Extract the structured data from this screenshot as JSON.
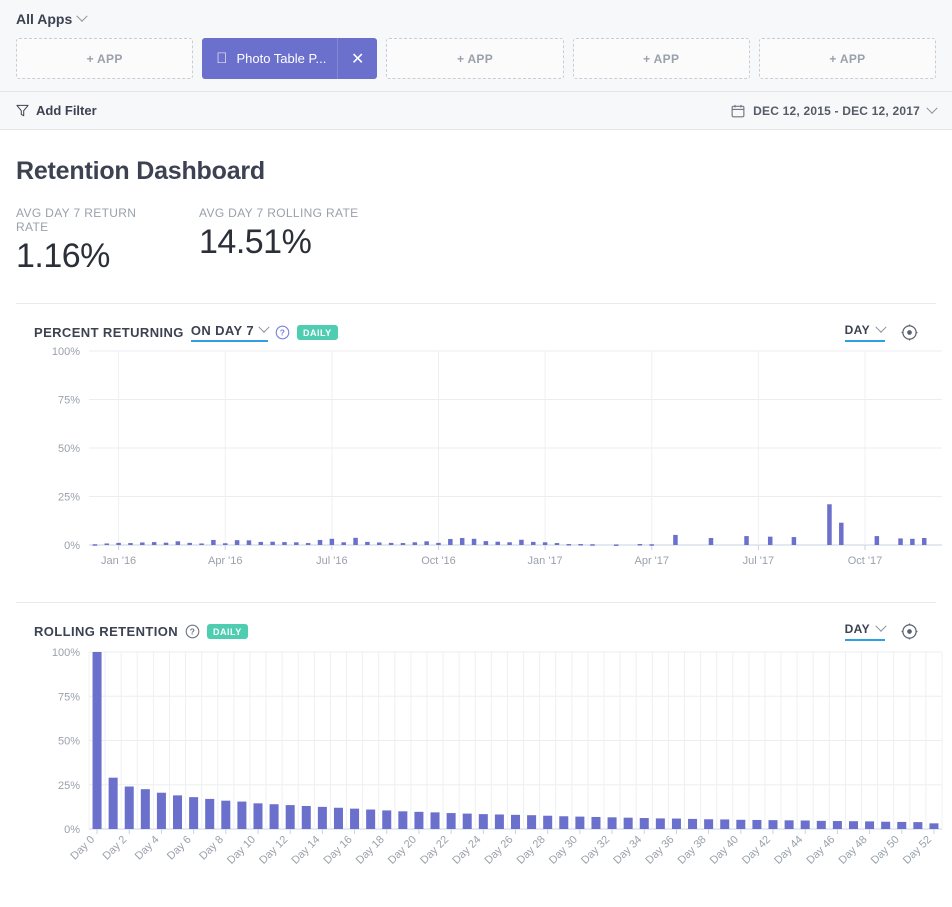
{
  "topbar": {
    "all_apps_label": "All Apps",
    "app_tabs": [
      {
        "label": "+ APP",
        "active": false
      },
      {
        "label": "Photo Table P...",
        "active": true,
        "icon": "apple-icon",
        "close_label": "✕"
      },
      {
        "label": "+ APP",
        "active": false
      },
      {
        "label": "+ APP",
        "active": false
      },
      {
        "label": "+ APP",
        "active": false
      }
    ]
  },
  "filterbar": {
    "add_filter_label": "Add Filter",
    "filter_icon": "funnel-icon",
    "date_range_label": "DEC 12, 2015 - DEC 12, 2017",
    "calendar_icon": "calendar-icon"
  },
  "page": {
    "title": "Retention Dashboard",
    "kpis": [
      {
        "label": "AVG DAY 7 RETURN RATE",
        "value": "1.16%"
      },
      {
        "label": "AVG DAY 7 ROLLING RATE",
        "value": "14.51%"
      }
    ]
  },
  "cards": [
    {
      "title_prefix": "PERCENT RETURNING",
      "title_dropdown": "ON DAY 7",
      "badge": "DAILY",
      "help_icon": "help-circle-icon",
      "granularity": "DAY",
      "settings_icon": "gear-icon"
    },
    {
      "title_prefix": "ROLLING RETENTION",
      "badge": "DAILY",
      "help_icon": "help-circle-icon",
      "granularity": "DAY",
      "settings_icon": "gear-icon"
    }
  ],
  "chart_data": [
    {
      "type": "bar",
      "title": "PERCENT RETURNING ON DAY 7",
      "xlabel": "",
      "ylabel": "",
      "ylim": [
        0,
        100
      ],
      "yticks": [
        0,
        25,
        50,
        75,
        100
      ],
      "ytick_labels": [
        "0%",
        "25%",
        "50%",
        "75%",
        "100%"
      ],
      "grid": true,
      "xtick_labels": [
        "Jan '16",
        "Apr '16",
        "Jul '16",
        "Oct '16",
        "Jan '17",
        "Apr '17",
        "Jul '17",
        "Oct '17"
      ],
      "xtick_positions": [
        2,
        11,
        20,
        29,
        38,
        47,
        56,
        65
      ],
      "color": "#6b70cc",
      "values": [
        0.4,
        0.8,
        1.1,
        1.0,
        1.3,
        1.5,
        1.2,
        1.9,
        1.1,
        0.8,
        2.6,
        0.9,
        2.5,
        2.4,
        1.6,
        1.7,
        1.5,
        1.4,
        1.0,
        2.6,
        3.2,
        1.4,
        3.7,
        1.6,
        1.3,
        1.1,
        1.0,
        1.4,
        1.9,
        1.1,
        3.1,
        3.6,
        3.2,
        2.0,
        1.7,
        1.4,
        2.7,
        1.6,
        1.4,
        1.0,
        0.5,
        0.5,
        0.4,
        0.0,
        0.3,
        0.0,
        0.5,
        0.4,
        0.0,
        5.2,
        0.0,
        0.0,
        3.6,
        0.0,
        0.0,
        4.6,
        0.0,
        4.3,
        0.0,
        4.1,
        0.0,
        0.0,
        21.0,
        11.5,
        0.0,
        0.0,
        4.6,
        0.0,
        3.4,
        3.2,
        3.6,
        0.0
      ]
    },
    {
      "type": "bar",
      "title": "ROLLING RETENTION",
      "xlabel": "",
      "ylabel": "",
      "ylim": [
        0,
        100
      ],
      "yticks": [
        0,
        25,
        50,
        75,
        100
      ],
      "ytick_labels": [
        "0%",
        "25%",
        "50%",
        "75%",
        "100%"
      ],
      "grid": true,
      "color": "#6b70cc",
      "categories": [
        "Day 0",
        "Day 1",
        "Day 2",
        "Day 3",
        "Day 4",
        "Day 5",
        "Day 6",
        "Day 7",
        "Day 8",
        "Day 9",
        "Day 10",
        "Day 11",
        "Day 12",
        "Day 13",
        "Day 14",
        "Day 15",
        "Day 16",
        "Day 17",
        "Day 18",
        "Day 19",
        "Day 20",
        "Day 21",
        "Day 22",
        "Day 23",
        "Day 24",
        "Day 25",
        "Day 26",
        "Day 27",
        "Day 28",
        "Day 29",
        "Day 30",
        "Day 31",
        "Day 32",
        "Day 33",
        "Day 34",
        "Day 35",
        "Day 36",
        "Day 37",
        "Day 38",
        "Day 39",
        "Day 40",
        "Day 41",
        "Day 42",
        "Day 43",
        "Day 44",
        "Day 45",
        "Day 46",
        "Day 47",
        "Day 48",
        "Day 49",
        "Day 50",
        "Day 51",
        "Day 52"
      ],
      "xtick_labels": [
        "Day 0",
        "Day 2",
        "Day 4",
        "Day 6",
        "Day 8",
        "Day 10",
        "Day 12",
        "Day 14",
        "Day 16",
        "Day 18",
        "Day 20",
        "Day 22",
        "Day 24",
        "Day 26",
        "Day 28",
        "Day 30",
        "Day 32",
        "Day 34",
        "Day 36",
        "Day 38",
        "Day 40",
        "Day 42",
        "Day 44",
        "Day 46",
        "Day 48",
        "Day 50",
        "Day 52"
      ],
      "values": [
        100.0,
        29.0,
        24.0,
        22.5,
        20.5,
        19.0,
        18.0,
        17.0,
        16.0,
        15.5,
        14.5,
        14.0,
        13.5,
        13.0,
        12.5,
        12.0,
        11.5,
        11.0,
        10.5,
        10.0,
        9.7,
        9.4,
        9.0,
        8.7,
        8.4,
        8.2,
        8.0,
        7.8,
        7.5,
        7.2,
        7.0,
        6.8,
        6.6,
        6.4,
        6.2,
        6.0,
        5.9,
        5.7,
        5.5,
        5.4,
        5.2,
        5.1,
        5.0,
        4.9,
        4.8,
        4.6,
        4.5,
        4.4,
        4.3,
        4.1,
        4.0,
        3.9,
        3.2
      ]
    }
  ]
}
